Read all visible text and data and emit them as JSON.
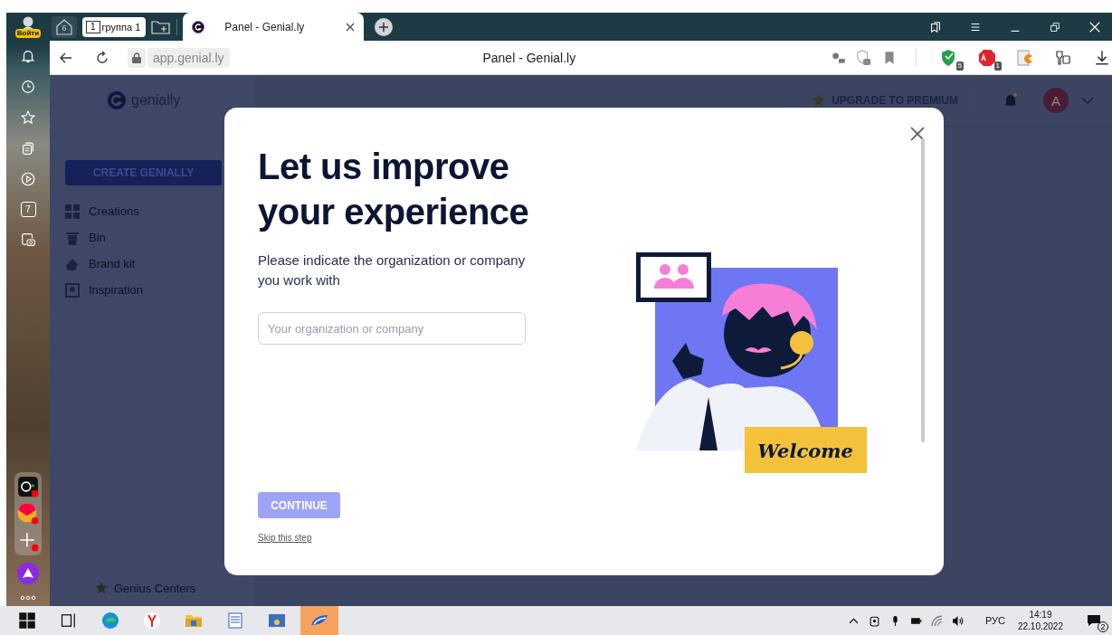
{
  "browser": {
    "profile_label": "Войти",
    "home_tab_count": "6",
    "group_tab": {
      "number": "1",
      "label": "группа 1"
    },
    "tabs": [
      {
        "title": "Panel - Genial.ly",
        "selected": true
      }
    ],
    "url": "app.genial.ly",
    "page_title": "Panel - Genial.ly",
    "extensions": [
      {
        "kind": "shield",
        "badge": "5"
      },
      {
        "kind": "adblock",
        "badge": "1"
      },
      {
        "kind": "pacman"
      },
      {
        "kind": "keys"
      }
    ],
    "side_badge": "7"
  },
  "app": {
    "logo": "genially",
    "create_button": "CREATE GENIALLY",
    "nav": [
      {
        "kind": "grid",
        "label": "Creations"
      },
      {
        "kind": "bin",
        "label": "Bin"
      },
      {
        "kind": "brand",
        "label": "Brand kit"
      },
      {
        "kind": "frame",
        "label": "Inspiration"
      }
    ],
    "footer_link": "Genius Centers",
    "upgrade_button": "UPGRADE TO PREMIUM",
    "avatar_letter": "A"
  },
  "modal": {
    "title": "Let us improve your experience",
    "subtitle": "Please indicate the organization or company you work with",
    "input": {
      "placeholder": "Your organization or company"
    },
    "continue_button": {
      "label": "CONTINUE",
      "disabled": true
    },
    "skip_link": "Skip this step",
    "welcome_label": "Welcome"
  },
  "taskbar": {
    "language": "РУС",
    "time": "14:19",
    "date": "22.10.2022",
    "notification_count": "2"
  }
}
